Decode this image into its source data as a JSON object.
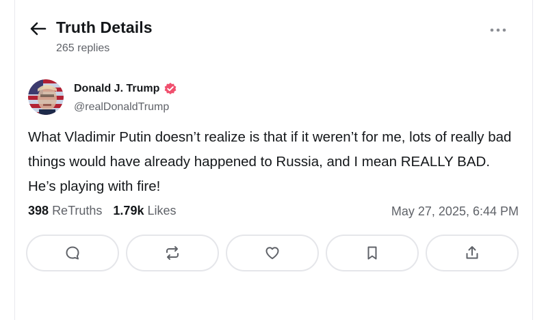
{
  "header": {
    "title": "Truth Details",
    "reply_count": "265 replies"
  },
  "post": {
    "author": {
      "name": "Donald J. Trump",
      "handle": "@realDonaldTrump",
      "verified_color": "#f0506e"
    },
    "text": "What Vladimir Putin doesn’t realize is that if it weren’t for me, lots of really bad things would have already happened to Russia, and I mean REALLY BAD. He’s playing with fire!",
    "retruths_count": "398",
    "retruths_label": "ReTruths",
    "likes_count": "1.79k",
    "likes_label": "Likes",
    "timestamp": "May 27, 2025, 6:44 PM"
  },
  "actions": [
    {
      "icon": "reply-icon"
    },
    {
      "icon": "retruth-icon"
    },
    {
      "icon": "heart-icon"
    },
    {
      "icon": "bookmark-icon"
    },
    {
      "icon": "share-icon"
    }
  ],
  "colors": {
    "text_primary": "#14171a",
    "text_secondary": "#5f6268",
    "border": "#e5e6ea",
    "icon": "#5f6268"
  }
}
